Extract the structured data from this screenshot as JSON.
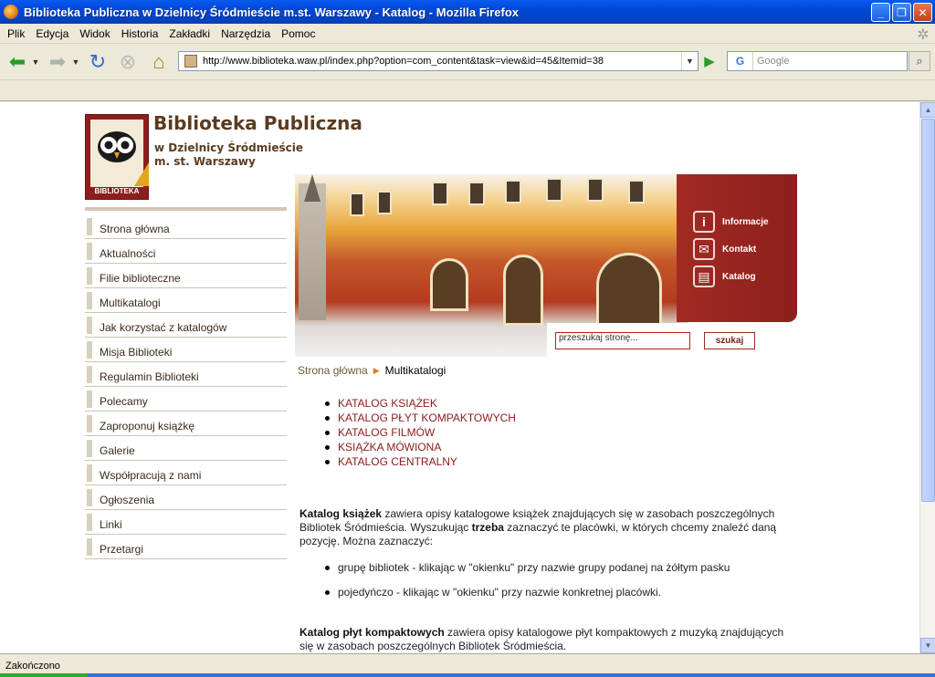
{
  "window": {
    "title": "Biblioteka Publiczna w Dzielnicy Śródmieście m.st. Warszawy - Katalog - Mozilla Firefox",
    "minimize": "_",
    "maximize": "❐",
    "close": "✕"
  },
  "menu": [
    "Plik",
    "Edycja",
    "Widok",
    "Historia",
    "Zakładki",
    "Narzędzia",
    "Pomoc"
  ],
  "toolbar": {
    "url": "http://www.biblioteka.waw.pl/index.php?option=com_content&task=view&id=45&Itemid=38",
    "search_engine": "G",
    "search_placeholder": "Google"
  },
  "status": "Zakończono",
  "site": {
    "title": "Biblioteka Publiczna",
    "subtitle_line1": "w Dzielnicy Śródmieście",
    "subtitle_line2": "m. st. Warszawy",
    "logo_word": "BIBLIOTEKA"
  },
  "quick_links": [
    {
      "label": "Informacje",
      "icon": "info-icon"
    },
    {
      "label": "Kontakt",
      "icon": "envelope-icon"
    },
    {
      "label": "Katalog",
      "icon": "book-icon"
    }
  ],
  "site_search": {
    "value": "przeszukaj stronę...",
    "button": "szukaj"
  },
  "nav": [
    "Strona główna",
    "Aktualności",
    "Filie biblioteczne",
    "Multikatalogi",
    "Jak korzystać z katalogów",
    "Misja Biblioteki",
    "Regulamin Biblioteki",
    "Polecamy",
    "Zaproponuj książkę",
    "Galerie",
    "Współpracują z nami",
    "Ogłoszenia",
    "Linki",
    "Przetargi"
  ],
  "breadcrumb": {
    "home": "Strona główna",
    "current": "Multikatalogi"
  },
  "catalogs": [
    "KATALOG KSIĄŻEK",
    "KATALOG PŁYT KOMPAKTOWYCH",
    "KATALOG FILMÓW",
    "KSIĄŻKA MÓWIONA",
    "KATALOG CENTRALNY"
  ],
  "content": {
    "p1_bold": "Katalog książek",
    "p1_a": " zawiera opisy katalogowe książek znajdujących się w zasobach poszczególnych Bibliotek Śródmieścia. Wyszukując ",
    "p1_bold2": "trzeba",
    "p1_b": " zaznaczyć te placówki, w których chcemy znaleźć daną pozycję. Można zaznaczyć:",
    "bullet1": "grupę bibliotek - klikając w \"okienku\" przy nazwie grupy podanej na żółtym pasku",
    "bullet2": "pojedyńczo - klikając w \"okienku\" przy nazwie konkretnej placówki.",
    "p2_bold": "Katalog płyt kompaktowych",
    "p2_a": "  zawiera opisy katalogowe płyt kompaktowych z muzyką znajdujących się w zasobach poszczególnych Bibliotek Śródmieścia."
  }
}
